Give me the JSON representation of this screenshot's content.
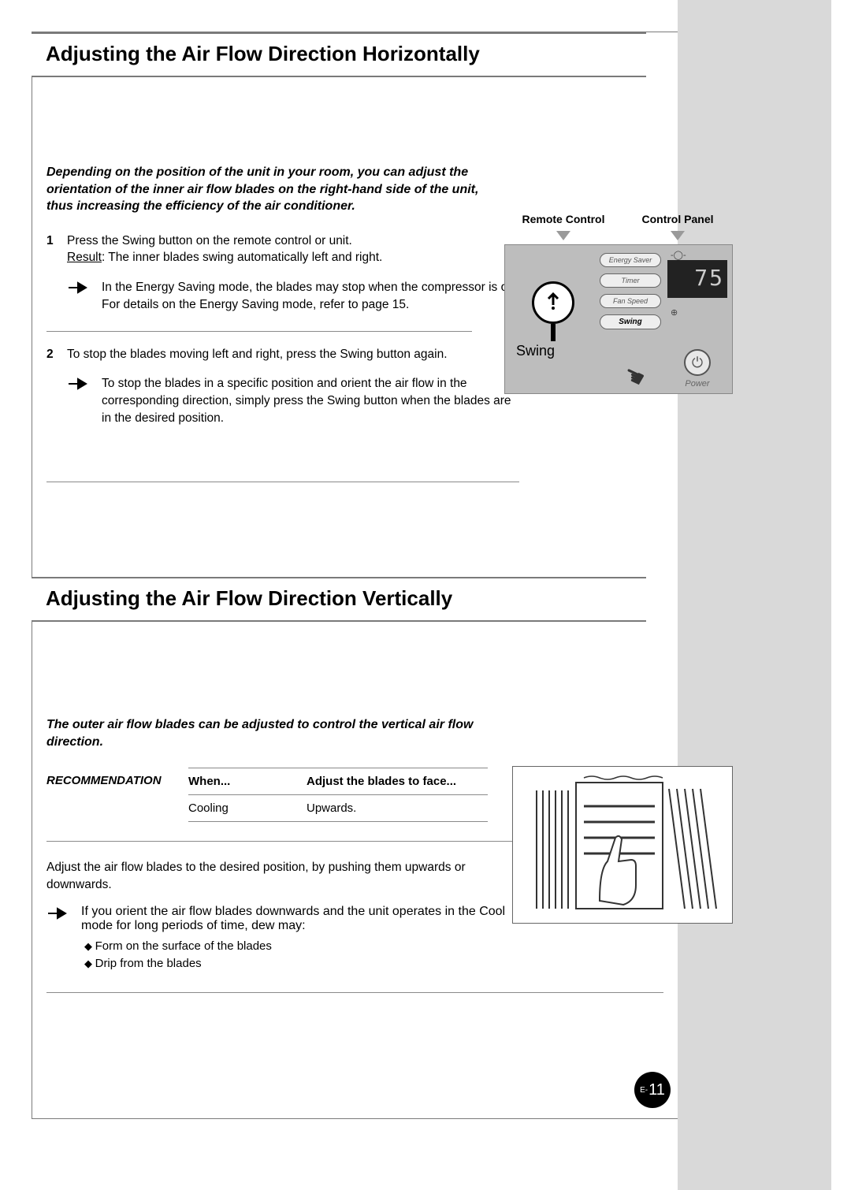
{
  "section1": {
    "title": "Adjusting the Air Flow Direction Horizontally",
    "intro": "Depending on the position of the unit in your room, you can adjust the orientation of the inner air flow blades on the right-hand side of the unit, thus increasing the efficiency of the air conditioner.",
    "step1_num": "1",
    "step1_text": "Press the Swing button on the remote control or unit.",
    "step1_result_label": "Result",
    "step1_result_text": ":   The inner blades swing automatically left and right.",
    "step1_note": "In the Energy Saving mode, the blades may stop when the compressor is off. For details on the Energy Saving mode, refer to page 15.",
    "step2_num": "2",
    "step2_text": "To stop the blades moving left and right, press the Swing button again.",
    "step2_note": "To stop the blades in a specific position and orient the air flow in the corresponding direction, simply press the Swing button when the blades are in the desired position."
  },
  "figure1": {
    "remote_label": "Remote Control",
    "panel_label": "Control Panel",
    "swing_label": "Swing",
    "buttons": {
      "energy": "Energy Saver",
      "timer": "Timer",
      "fan": "Fan Speed",
      "swing": "Swing"
    },
    "display": "75",
    "power_label": "Power"
  },
  "section2": {
    "title": "Adjusting the Air Flow Direction Vertically",
    "intro": "The outer air flow blades can be adjusted to control the vertical air flow direction.",
    "recommendation_label": "RECOMMENDATION",
    "table": {
      "h1": "When...",
      "h2": "Adjust the blades to face...",
      "r1c1": "Cooling",
      "r1c2": "Upwards."
    },
    "adjust_text": "Adjust the air flow blades to the desired position, by pushing them upwards or downwards.",
    "note": "If you orient the air flow blades downwards and the unit operates in the Cool mode for long periods of time, dew may:",
    "bullet1": "Form on the surface of the blades",
    "bullet2": "Drip from the blades"
  },
  "page": {
    "prefix": "E-",
    "number": "11"
  }
}
